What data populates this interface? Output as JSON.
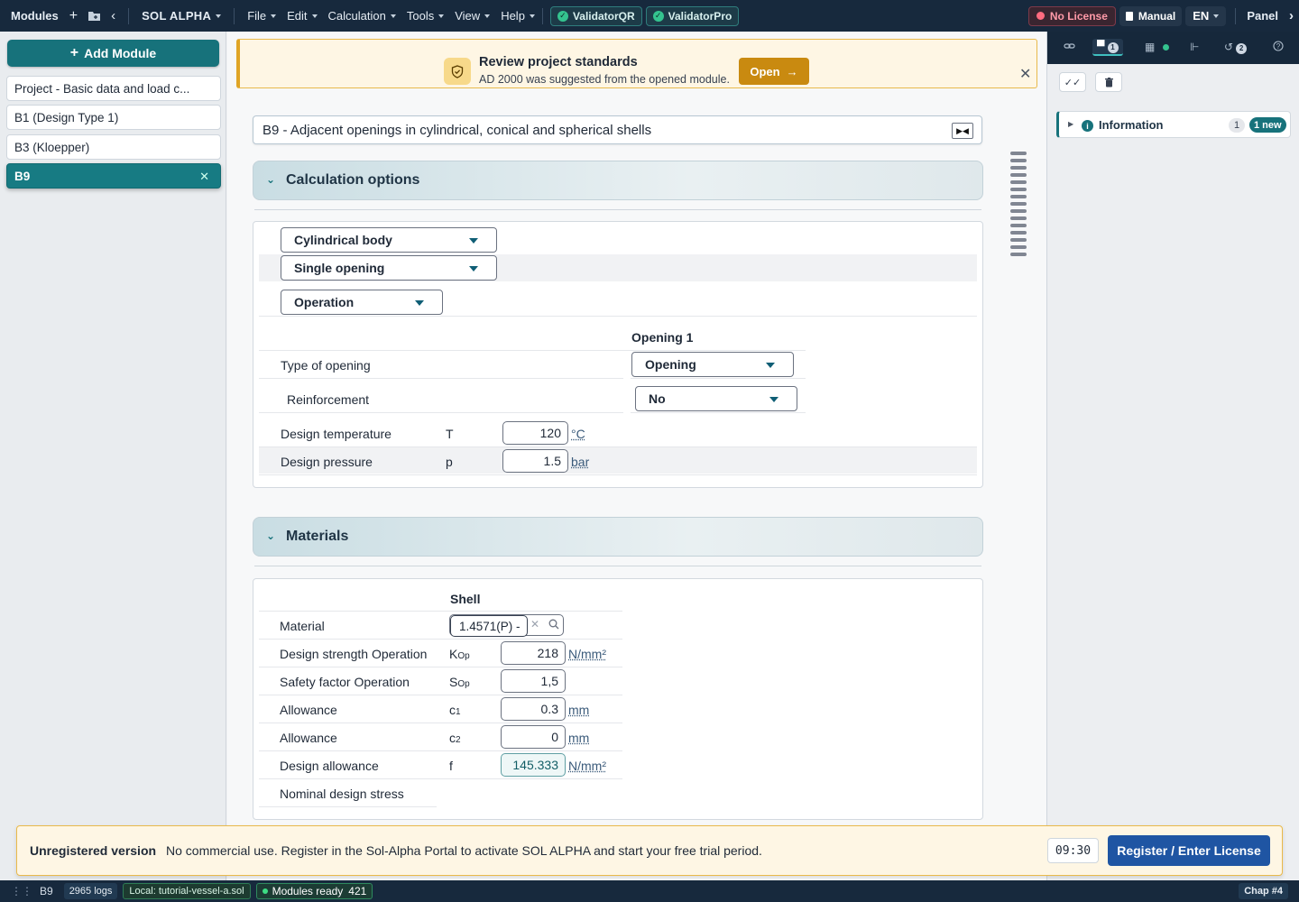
{
  "topbar": {
    "modules_label": "Modules",
    "app_name": "SOL ALPHA",
    "menus": [
      "File",
      "Edit",
      "Calculation",
      "Tools",
      "View",
      "Help"
    ],
    "validators": [
      "ValidatorQR",
      "ValidatorPro"
    ],
    "license_label": "No License",
    "manual_label": "Manual",
    "language": "EN",
    "panel_label": "Panel"
  },
  "sidebar": {
    "add_module_label": "Add Module",
    "modules": [
      {
        "label": "Project - Basic data and load c..."
      },
      {
        "label": "B1 (Design Type 1)"
      },
      {
        "label": "B3 (Kloepper)"
      },
      {
        "label": "B9",
        "active": true
      }
    ]
  },
  "banner": {
    "title": "Review project standards",
    "subtitle": "AD 2000 was suggested from the opened module.",
    "open_label": "Open"
  },
  "module": {
    "title": "B9 - Adjacent openings in cylindrical, conical and spherical shells"
  },
  "calc_options": {
    "section_label": "Calculation options",
    "body_type": "Cylindrical body",
    "opening_mode": "Single opening",
    "load_case": "Operation",
    "opening_header": "Opening 1",
    "type_of_opening_label": "Type of opening",
    "type_of_opening_value": "Opening",
    "reinforcement_label": "Reinforcement",
    "reinforcement_value": "No",
    "temp_label": "Design temperature",
    "temp_symbol": "T",
    "temp_value": "120",
    "temp_unit": "°C",
    "pressure_label": "Design pressure",
    "pressure_symbol": "p",
    "pressure_value": "1.5",
    "pressure_unit": "bar"
  },
  "materials": {
    "section_label": "Materials",
    "column_header": "Shell",
    "material_label": "Material",
    "material_value": "1.4571(P) -",
    "rows": [
      {
        "label": "Design strength Operation",
        "symbol": "K",
        "sub": "Op",
        "value": "218",
        "unit": "N/mm²"
      },
      {
        "label": "Safety factor Operation",
        "symbol": "S",
        "sub": "Op",
        "value": "1,5",
        "unit": ""
      },
      {
        "label": "Allowance",
        "symbol": "c",
        "sub": "1",
        "value": "0.3",
        "unit": "mm"
      },
      {
        "label": "Allowance",
        "symbol": "c",
        "sub": "2",
        "value": "0",
        "unit": "mm"
      },
      {
        "label": "Design allowance",
        "symbol": "f",
        "sub": "",
        "value": "145.333",
        "unit": "N/mm²"
      }
    ],
    "nominal_label": "Nominal design stress"
  },
  "right_panel": {
    "tab_messages_count": "1",
    "tab_history_count": "2",
    "info_label": "Information",
    "info_count": "1",
    "info_new": "1 new"
  },
  "license_bar": {
    "title": "Unregistered version",
    "text": "No commercial use. Register in the Sol-Alpha Portal to activate SOL ALPHA and start your free trial period.",
    "timer": "09:30",
    "button_label": "Register / Enter License"
  },
  "statusbar": {
    "module": "B9",
    "logs": "2965 logs",
    "file": "Local: tutorial-vessel-a.sol",
    "modules_ready": "Modules ready",
    "modules_ready_count": "421",
    "chapter": "Chap #4"
  }
}
